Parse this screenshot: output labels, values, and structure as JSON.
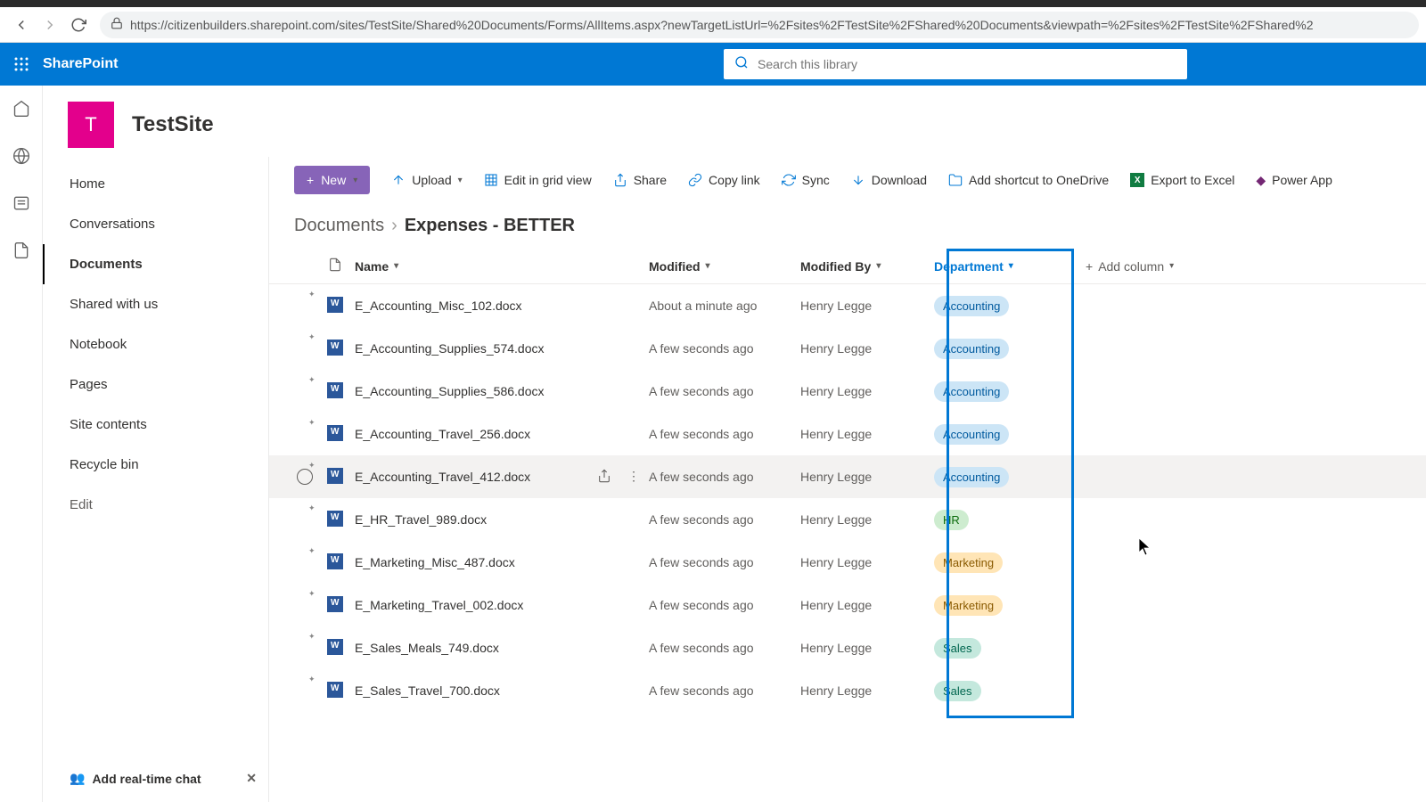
{
  "browser": {
    "url": "https://citizenbuilders.sharepoint.com/sites/TestSite/Shared%20Documents/Forms/AllItems.aspx?newTargetListUrl=%2Fsites%2FTestSite%2FShared%20Documents&viewpath=%2Fsites%2FTestSite%2FShared%2"
  },
  "header": {
    "brand": "SharePoint",
    "search_placeholder": "Search this library"
  },
  "site": {
    "initial": "T",
    "title": "TestSite"
  },
  "leftnav": {
    "items": [
      {
        "label": "Home"
      },
      {
        "label": "Conversations"
      },
      {
        "label": "Documents"
      },
      {
        "label": "Shared with us"
      },
      {
        "label": "Notebook"
      },
      {
        "label": "Pages"
      },
      {
        "label": "Site contents"
      },
      {
        "label": "Recycle bin"
      }
    ],
    "edit": "Edit",
    "promo": "Add real-time chat"
  },
  "cmdbar": {
    "new": "New",
    "upload": "Upload",
    "grid": "Edit in grid view",
    "share": "Share",
    "copy": "Copy link",
    "sync": "Sync",
    "download": "Download",
    "shortcut": "Add shortcut to OneDrive",
    "excel": "Export to Excel",
    "power": "Power App"
  },
  "breadcrumb": {
    "root": "Documents",
    "current": "Expenses - BETTER"
  },
  "columns": {
    "name": "Name",
    "modified": "Modified",
    "modifiedby": "Modified By",
    "department": "Department",
    "add": "Add column"
  },
  "rows": [
    {
      "name": "E_Accounting_Misc_102.docx",
      "modified": "About a minute ago",
      "by": "Henry Legge",
      "dept": "Accounting",
      "cls": "accounting"
    },
    {
      "name": "E_Accounting_Supplies_574.docx",
      "modified": "A few seconds ago",
      "by": "Henry Legge",
      "dept": "Accounting",
      "cls": "accounting"
    },
    {
      "name": "E_Accounting_Supplies_586.docx",
      "modified": "A few seconds ago",
      "by": "Henry Legge",
      "dept": "Accounting",
      "cls": "accounting"
    },
    {
      "name": "E_Accounting_Travel_256.docx",
      "modified": "A few seconds ago",
      "by": "Henry Legge",
      "dept": "Accounting",
      "cls": "accounting"
    },
    {
      "name": "E_Accounting_Travel_412.docx",
      "modified": "A few seconds ago",
      "by": "Henry Legge",
      "dept": "Accounting",
      "cls": "accounting",
      "hover": true
    },
    {
      "name": "E_HR_Travel_989.docx",
      "modified": "A few seconds ago",
      "by": "Henry Legge",
      "dept": "HR",
      "cls": "hr"
    },
    {
      "name": "E_Marketing_Misc_487.docx",
      "modified": "A few seconds ago",
      "by": "Henry Legge",
      "dept": "Marketing",
      "cls": "marketing"
    },
    {
      "name": "E_Marketing_Travel_002.docx",
      "modified": "A few seconds ago",
      "by": "Henry Legge",
      "dept": "Marketing",
      "cls": "marketing"
    },
    {
      "name": "E_Sales_Meals_749.docx",
      "modified": "A few seconds ago",
      "by": "Henry Legge",
      "dept": "Sales",
      "cls": "sales"
    },
    {
      "name": "E_Sales_Travel_700.docx",
      "modified": "A few seconds ago",
      "by": "Henry Legge",
      "dept": "Sales",
      "cls": "sales"
    }
  ]
}
